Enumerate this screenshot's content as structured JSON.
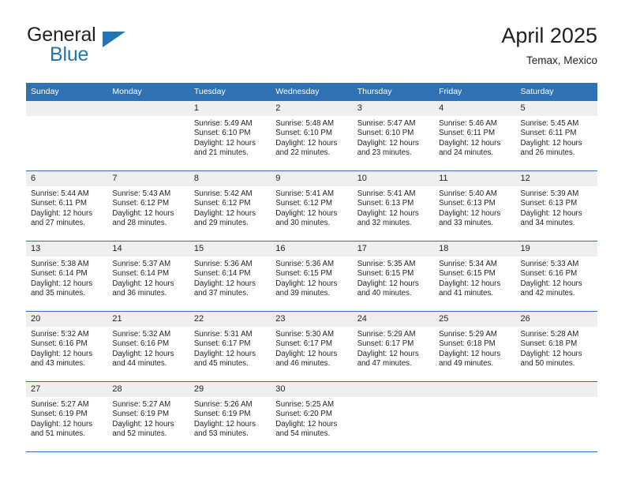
{
  "brand": {
    "name_top": "General",
    "name_bottom": "Blue",
    "triangle_icon": "triangle-icon",
    "accent_color": "#2474b5"
  },
  "header": {
    "title": "April 2025",
    "subtitle": "Temax, Mexico"
  },
  "colors": {
    "header_blue": "#3071b3",
    "daynum_band": "#efefef",
    "text": "#231f20"
  },
  "weekday_headers": [
    "Sunday",
    "Monday",
    "Tuesday",
    "Wednesday",
    "Thursday",
    "Friday",
    "Saturday"
  ],
  "weeks": [
    [
      {
        "day": "",
        "empty": true
      },
      {
        "day": "",
        "empty": true
      },
      {
        "day": "1",
        "sunrise": "Sunrise: 5:49 AM",
        "sunset": "Sunset: 6:10 PM",
        "daylight": "Daylight: 12 hours and 21 minutes."
      },
      {
        "day": "2",
        "sunrise": "Sunrise: 5:48 AM",
        "sunset": "Sunset: 6:10 PM",
        "daylight": "Daylight: 12 hours and 22 minutes."
      },
      {
        "day": "3",
        "sunrise": "Sunrise: 5:47 AM",
        "sunset": "Sunset: 6:10 PM",
        "daylight": "Daylight: 12 hours and 23 minutes."
      },
      {
        "day": "4",
        "sunrise": "Sunrise: 5:46 AM",
        "sunset": "Sunset: 6:11 PM",
        "daylight": "Daylight: 12 hours and 24 minutes."
      },
      {
        "day": "5",
        "sunrise": "Sunrise: 5:45 AM",
        "sunset": "Sunset: 6:11 PM",
        "daylight": "Daylight: 12 hours and 26 minutes."
      }
    ],
    [
      {
        "day": "6",
        "sunrise": "Sunrise: 5:44 AM",
        "sunset": "Sunset: 6:11 PM",
        "daylight": "Daylight: 12 hours and 27 minutes."
      },
      {
        "day": "7",
        "sunrise": "Sunrise: 5:43 AM",
        "sunset": "Sunset: 6:12 PM",
        "daylight": "Daylight: 12 hours and 28 minutes."
      },
      {
        "day": "8",
        "sunrise": "Sunrise: 5:42 AM",
        "sunset": "Sunset: 6:12 PM",
        "daylight": "Daylight: 12 hours and 29 minutes."
      },
      {
        "day": "9",
        "sunrise": "Sunrise: 5:41 AM",
        "sunset": "Sunset: 6:12 PM",
        "daylight": "Daylight: 12 hours and 30 minutes."
      },
      {
        "day": "10",
        "sunrise": "Sunrise: 5:41 AM",
        "sunset": "Sunset: 6:13 PM",
        "daylight": "Daylight: 12 hours and 32 minutes."
      },
      {
        "day": "11",
        "sunrise": "Sunrise: 5:40 AM",
        "sunset": "Sunset: 6:13 PM",
        "daylight": "Daylight: 12 hours and 33 minutes."
      },
      {
        "day": "12",
        "sunrise": "Sunrise: 5:39 AM",
        "sunset": "Sunset: 6:13 PM",
        "daylight": "Daylight: 12 hours and 34 minutes."
      }
    ],
    [
      {
        "day": "13",
        "sunrise": "Sunrise: 5:38 AM",
        "sunset": "Sunset: 6:14 PM",
        "daylight": "Daylight: 12 hours and 35 minutes."
      },
      {
        "day": "14",
        "sunrise": "Sunrise: 5:37 AM",
        "sunset": "Sunset: 6:14 PM",
        "daylight": "Daylight: 12 hours and 36 minutes."
      },
      {
        "day": "15",
        "sunrise": "Sunrise: 5:36 AM",
        "sunset": "Sunset: 6:14 PM",
        "daylight": "Daylight: 12 hours and 37 minutes."
      },
      {
        "day": "16",
        "sunrise": "Sunrise: 5:36 AM",
        "sunset": "Sunset: 6:15 PM",
        "daylight": "Daylight: 12 hours and 39 minutes."
      },
      {
        "day": "17",
        "sunrise": "Sunrise: 5:35 AM",
        "sunset": "Sunset: 6:15 PM",
        "daylight": "Daylight: 12 hours and 40 minutes."
      },
      {
        "day": "18",
        "sunrise": "Sunrise: 5:34 AM",
        "sunset": "Sunset: 6:15 PM",
        "daylight": "Daylight: 12 hours and 41 minutes."
      },
      {
        "day": "19",
        "sunrise": "Sunrise: 5:33 AM",
        "sunset": "Sunset: 6:16 PM",
        "daylight": "Daylight: 12 hours and 42 minutes."
      }
    ],
    [
      {
        "day": "20",
        "sunrise": "Sunrise: 5:32 AM",
        "sunset": "Sunset: 6:16 PM",
        "daylight": "Daylight: 12 hours and 43 minutes."
      },
      {
        "day": "21",
        "sunrise": "Sunrise: 5:32 AM",
        "sunset": "Sunset: 6:16 PM",
        "daylight": "Daylight: 12 hours and 44 minutes."
      },
      {
        "day": "22",
        "sunrise": "Sunrise: 5:31 AM",
        "sunset": "Sunset: 6:17 PM",
        "daylight": "Daylight: 12 hours and 45 minutes."
      },
      {
        "day": "23",
        "sunrise": "Sunrise: 5:30 AM",
        "sunset": "Sunset: 6:17 PM",
        "daylight": "Daylight: 12 hours and 46 minutes."
      },
      {
        "day": "24",
        "sunrise": "Sunrise: 5:29 AM",
        "sunset": "Sunset: 6:17 PM",
        "daylight": "Daylight: 12 hours and 47 minutes."
      },
      {
        "day": "25",
        "sunrise": "Sunrise: 5:29 AM",
        "sunset": "Sunset: 6:18 PM",
        "daylight": "Daylight: 12 hours and 49 minutes."
      },
      {
        "day": "26",
        "sunrise": "Sunrise: 5:28 AM",
        "sunset": "Sunset: 6:18 PM",
        "daylight": "Daylight: 12 hours and 50 minutes."
      }
    ],
    [
      {
        "day": "27",
        "sunrise": "Sunrise: 5:27 AM",
        "sunset": "Sunset: 6:19 PM",
        "daylight": "Daylight: 12 hours and 51 minutes."
      },
      {
        "day": "28",
        "sunrise": "Sunrise: 5:27 AM",
        "sunset": "Sunset: 6:19 PM",
        "daylight": "Daylight: 12 hours and 52 minutes."
      },
      {
        "day": "29",
        "sunrise": "Sunrise: 5:26 AM",
        "sunset": "Sunset: 6:19 PM",
        "daylight": "Daylight: 12 hours and 53 minutes."
      },
      {
        "day": "30",
        "sunrise": "Sunrise: 5:25 AM",
        "sunset": "Sunset: 6:20 PM",
        "daylight": "Daylight: 12 hours and 54 minutes."
      },
      {
        "day": "",
        "empty": true
      },
      {
        "day": "",
        "empty": true
      },
      {
        "day": "",
        "empty": true
      }
    ]
  ]
}
